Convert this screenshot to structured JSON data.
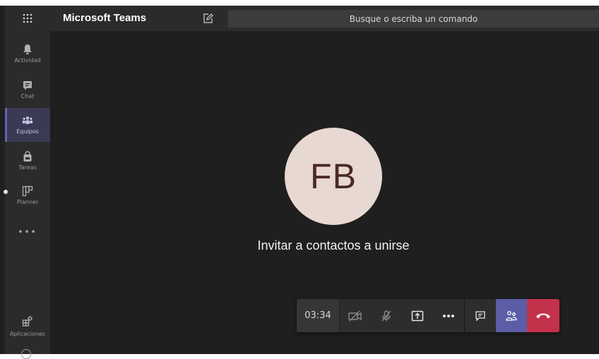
{
  "app": {
    "title": "Microsoft Teams"
  },
  "search": {
    "placeholder": "Busque o escriba un comando"
  },
  "rail": {
    "items": [
      {
        "label": "Actividad",
        "icon": "bell-icon"
      },
      {
        "label": "Chat",
        "icon": "chat-icon"
      },
      {
        "label": "Equipos",
        "icon": "teams-icon",
        "active": true
      },
      {
        "label": "Tareas",
        "icon": "bag-icon"
      },
      {
        "label": "Planner",
        "icon": "planner-icon"
      }
    ],
    "more": "•••",
    "apps_label": "Aplicaciones"
  },
  "call": {
    "avatar_initials": "FB",
    "invite_text": "Invitar a contactos a unirse",
    "timer": "03:34"
  },
  "colors": {
    "accent": "#6264a7",
    "hangup": "#c4314b",
    "avatar_bg": "#e8d8d2"
  }
}
